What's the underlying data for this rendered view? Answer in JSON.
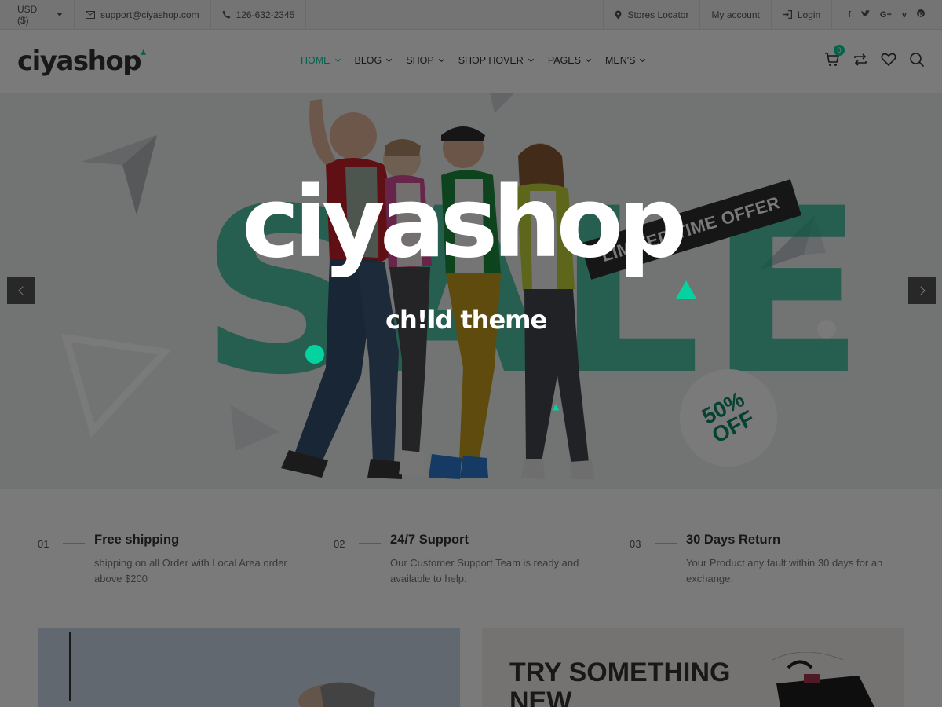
{
  "topbar": {
    "currency": "USD ($)",
    "email": "support@ciyashop.com",
    "phone": "126-632-2345",
    "stores_locator": "Stores Locator",
    "my_account": "My account",
    "login": "Login",
    "social": [
      "facebook-icon",
      "twitter-icon",
      "google-plus-icon",
      "vimeo-icon",
      "pinterest-icon"
    ]
  },
  "header": {
    "logo": "ciyashop",
    "nav": [
      {
        "label": "HOME",
        "active": true
      },
      {
        "label": "BLOG"
      },
      {
        "label": "SHOP"
      },
      {
        "label": "SHOP HOVER"
      },
      {
        "label": "PAGES"
      },
      {
        "label": "MEN'S"
      }
    ],
    "cart_count": "0"
  },
  "hero": {
    "logo_text": "ciyashop",
    "subtitle": "ch!ld theme",
    "limited_offer": "LIMITED TIME OFFER",
    "off_top": "50%",
    "off_bottom": "OFF",
    "sale_text": "SALE"
  },
  "features": [
    {
      "num": "01",
      "title": "Free shipping",
      "desc": "shipping on all Order with Local Area order above $200"
    },
    {
      "num": "02",
      "title": "24/7 Support",
      "desc": "Our Customer Support Team is ready and available to help."
    },
    {
      "num": "03",
      "title": "30 Days Return",
      "desc": "Your Product any fault within 30 days for an exchange."
    }
  ],
  "banner_right": {
    "title": "TRY SOMETHING NEW"
  },
  "colors": {
    "accent": "#04d39f",
    "overlay": "rgba(0,0,0,0.52)"
  }
}
